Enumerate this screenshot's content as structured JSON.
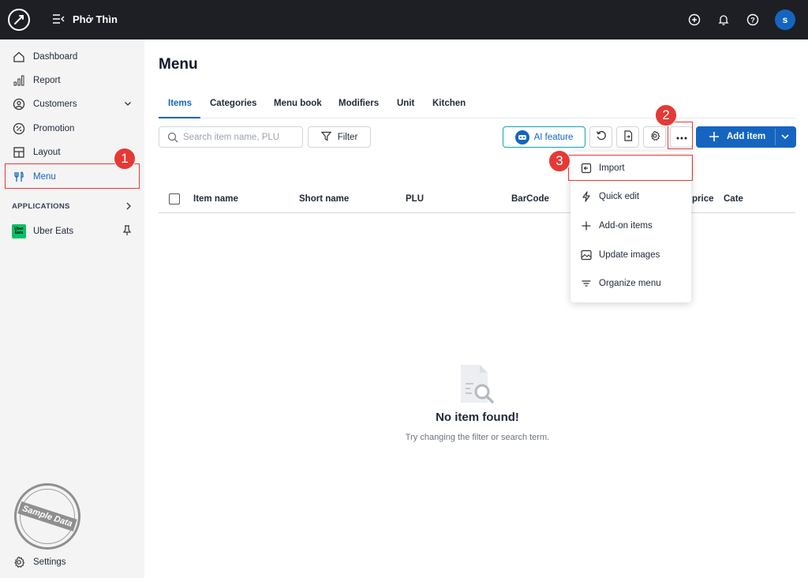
{
  "topbar": {
    "store_name": "Phở Thìn",
    "avatar_initial": "s",
    "icons": [
      "logo-icon",
      "menu-toggle-icon",
      "add-circle-icon",
      "bell-icon",
      "help-icon"
    ]
  },
  "sidebar": {
    "items": [
      {
        "label": "Dashboard",
        "icon": "home-icon"
      },
      {
        "label": "Report",
        "icon": "bar-chart-icon"
      },
      {
        "label": "Customers",
        "icon": "user-circle-icon"
      },
      {
        "label": "Promotion",
        "icon": "percent-icon"
      },
      {
        "label": "Layout",
        "icon": "layout-icon"
      },
      {
        "label": "Menu",
        "icon": "fork-knife-icon"
      }
    ],
    "applications_heading": "APPLICATIONS",
    "app_item": {
      "label": "Uber Eats",
      "logo_text": "Uber Eats"
    },
    "settings_label": "Settings",
    "stamp_text": "Sample Data"
  },
  "main": {
    "title": "Menu",
    "tabs": [
      {
        "label": "Items",
        "active": true
      },
      {
        "label": "Categories"
      },
      {
        "label": "Menu book"
      },
      {
        "label": "Modifiers"
      },
      {
        "label": "Unit"
      },
      {
        "label": "Kitchen"
      }
    ],
    "search_placeholder": "Search item name, PLU",
    "filter_label": "Filter",
    "ai_feature_label": "AI feature",
    "add_item_label": "Add item",
    "table_columns": [
      "Item name",
      "Short name",
      "PLU",
      "BarCode",
      "price",
      "Cate"
    ],
    "dropdown": [
      "Import",
      "Quick edit",
      "Add-on items",
      "Update images",
      "Organize menu"
    ],
    "empty_title": "No item found!",
    "empty_subtitle": "Try changing the filter or search term."
  },
  "annotations": {
    "step1": "1",
    "step2": "2",
    "step3": "3"
  },
  "colors": {
    "accent": "#1565c0",
    "annotation_red": "#e53935",
    "topbar_bg": "#1d1f25",
    "sidebar_bg": "#f4f4f5"
  }
}
